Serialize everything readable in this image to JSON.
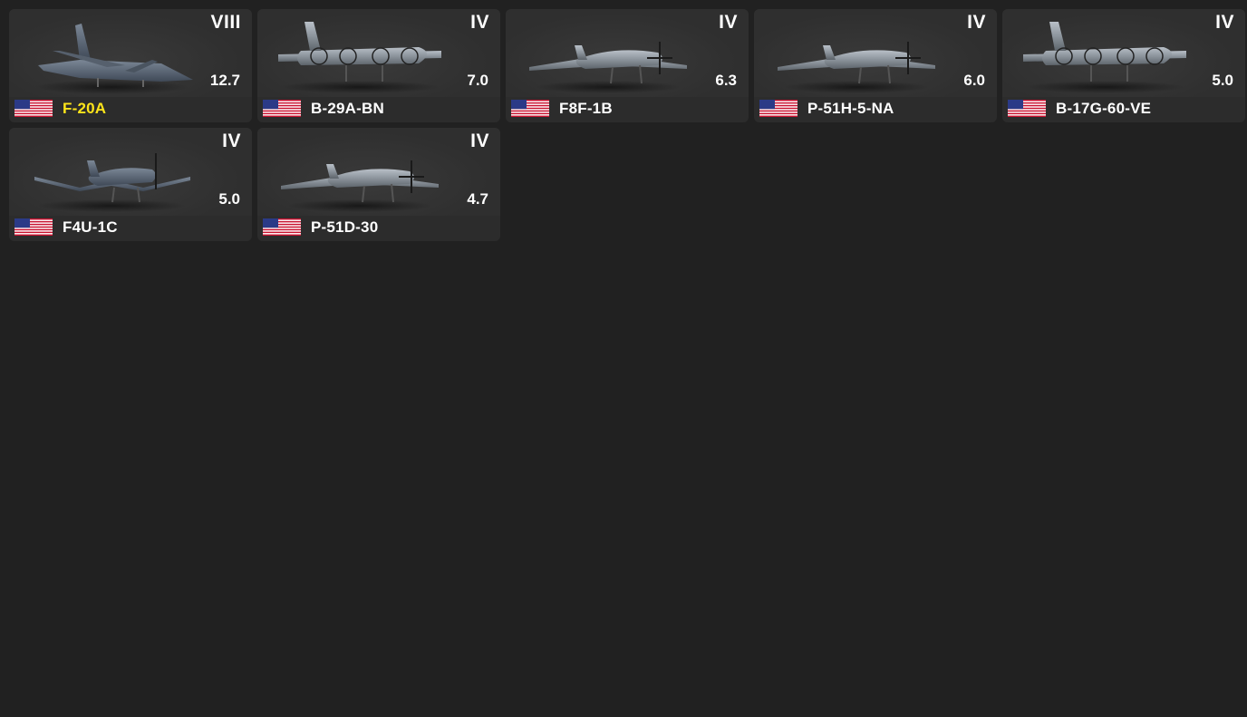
{
  "vehicles": [
    {
      "name": "F-20A",
      "rank": "VIII",
      "br": "12.7",
      "country": "usa-flag-icon",
      "highlight": true,
      "silhouette": "jet"
    },
    {
      "name": "B-29A-BN",
      "rank": "IV",
      "br": "7.0",
      "country": "usa-flag-icon",
      "highlight": false,
      "silhouette": "bomber"
    },
    {
      "name": "F8F-1B",
      "rank": "IV",
      "br": "6.3",
      "country": "usa-flag-icon",
      "highlight": false,
      "silhouette": "fighter"
    },
    {
      "name": "P-51H-5-NA",
      "rank": "IV",
      "br": "6.0",
      "country": "usa-flag-icon",
      "highlight": false,
      "silhouette": "fighter"
    },
    {
      "name": "B-17G-60-VE",
      "rank": "IV",
      "br": "5.0",
      "country": "usa-flag-icon",
      "highlight": false,
      "silhouette": "bomber"
    },
    {
      "name": "F4U-1C",
      "rank": "IV",
      "br": "5.0",
      "country": "usa-flag-icon",
      "highlight": false,
      "silhouette": "gullwing"
    },
    {
      "name": "P-51D-30",
      "rank": "IV",
      "br": "4.7",
      "country": "usa-flag-icon",
      "highlight": false,
      "silhouette": "fighter"
    }
  ],
  "colors": {
    "background": "#212121",
    "card": "#2f2f2f",
    "highlight_name": "#ffe51a",
    "text": "#ffffff"
  }
}
